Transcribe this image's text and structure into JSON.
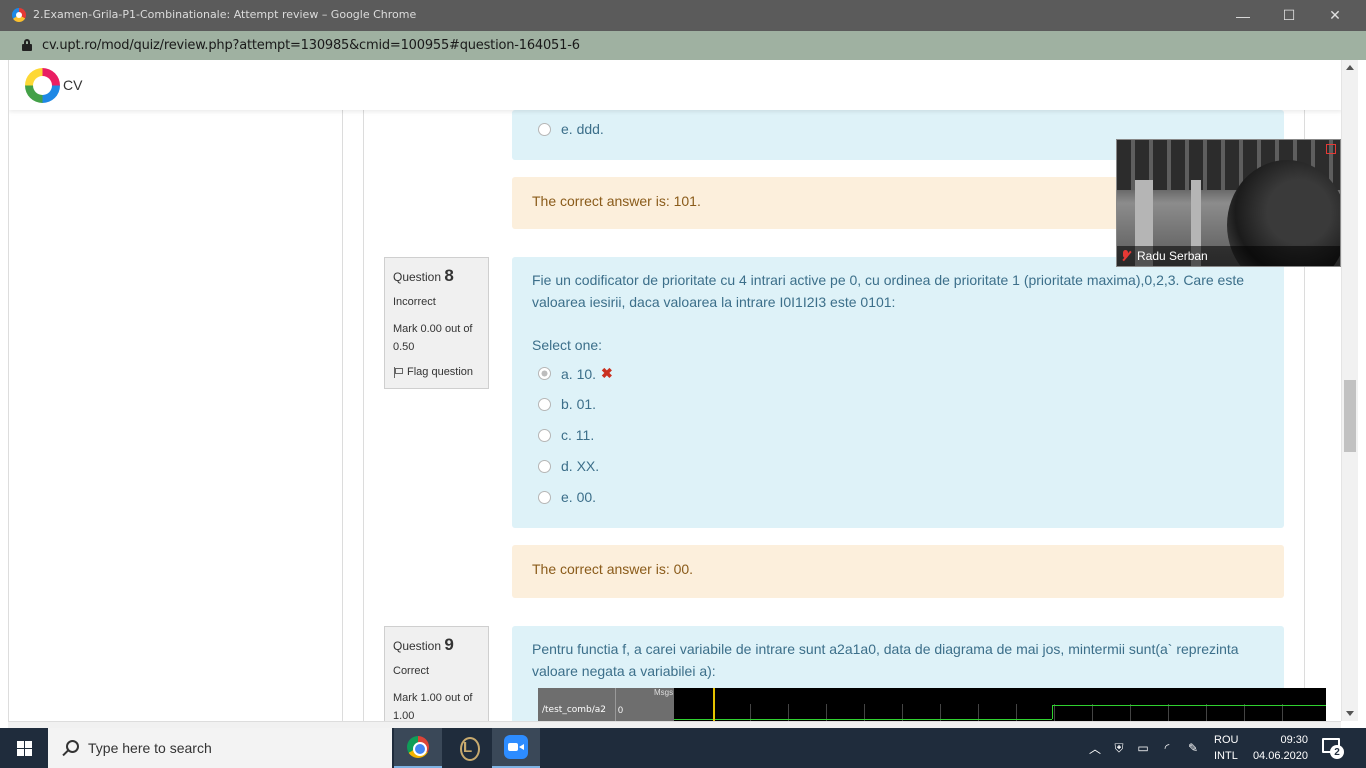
{
  "window": {
    "title": "2.Examen-Grila-P1-Combinationale: Attempt review – Google Chrome",
    "url": "cv.upt.ro/mod/quiz/review.php?attempt=130985&cmid=100955#question-164051-6"
  },
  "site": {
    "logo_text": "CV"
  },
  "prev_question": {
    "last_option": "e. ddd.",
    "feedback": "The correct answer is: 101."
  },
  "question8": {
    "label": "Question",
    "number": "8",
    "state": "Incorrect",
    "grade": "Mark 0.00 out of 0.50",
    "flag": "Flag question",
    "text": "Fie un codificator de prioritate cu 4 intrari active pe 0, cu ordinea de prioritate 1 (prioritate maxima),0,2,3. Care este valoarea iesirii, daca valoarea la intrare I0I1I2I3 este 0101:",
    "prompt": "Select one:",
    "options": [
      "a. 10.",
      "b. 01.",
      "c. 11.",
      "d. XX.",
      "e. 00."
    ],
    "feedback": "The correct answer is: 00."
  },
  "question9": {
    "label": "Question",
    "number": "9",
    "state": "Correct",
    "grade": "Mark 1.00 out of 1.00",
    "text": "Pentru functia f, a carei variabile de intrare sunt a2a1a0, data de diagrama de mai jos, mintermii sunt(a` reprezinta valoare negata a variabilei a):",
    "waveform": {
      "header": "Msgs",
      "signal_name": "/test_comb/a2",
      "signal_value": "0"
    }
  },
  "webcam": {
    "name": "Radu Serban"
  },
  "taskbar": {
    "search_placeholder": "Type here to search",
    "lang_line1": "ROU",
    "lang_line2": "INTL",
    "time": "09:30",
    "date": "04.06.2020",
    "notifications": "2"
  },
  "colors": {
    "answer_bg": "#def2f8",
    "feedback_bg": "#fcefdc",
    "wrong_mark": "#ca3120",
    "taskbar_bg": "#1f2c3c"
  }
}
